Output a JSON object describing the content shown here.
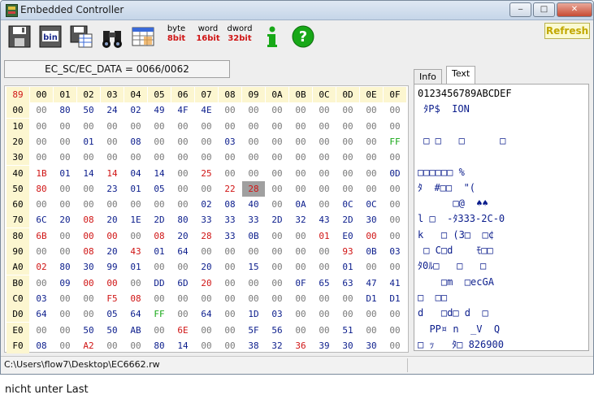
{
  "window": {
    "title": "Embedded Controller",
    "min": "‒",
    "max": "□",
    "close": "✕"
  },
  "toolbar": {
    "buttons": [
      {
        "name": "save",
        "icon": "floppy-disk-icon"
      },
      {
        "name": "open-bin",
        "icon": "bin-file-icon",
        "label": "bin"
      },
      {
        "name": "save-as",
        "icon": "floppy-grid-icon"
      },
      {
        "name": "find",
        "icon": "binoculars-icon"
      },
      {
        "name": "table",
        "icon": "table-icon"
      }
    ],
    "byte": {
      "top": "byte",
      "bottom": "8bit"
    },
    "word": {
      "top": "word",
      "bottom": "16bit"
    },
    "dword": {
      "top": "dword",
      "bottom": "32bit"
    },
    "info_icon": "info-icon",
    "help_icon": "help-icon",
    "refresh_label": "Refresh",
    "accent_colors": {
      "byte": "#d01515",
      "word": "#d01515",
      "dword": "#d01515"
    }
  },
  "ec_label": "EC_SC/EC_DATA = 0066/0062",
  "hex": {
    "corner": "89",
    "cols": [
      "00",
      "01",
      "02",
      "03",
      "04",
      "05",
      "06",
      "07",
      "08",
      "09",
      "0A",
      "0B",
      "0C",
      "0D",
      "0E",
      "0F"
    ],
    "rows": [
      {
        "addr": "00",
        "vals": [
          "00",
          "80",
          "50",
          "24",
          "02",
          "49",
          "4F",
          "4E",
          "00",
          "00",
          "00",
          "00",
          "00",
          "00",
          "00",
          "00"
        ]
      },
      {
        "addr": "10",
        "vals": [
          "00",
          "00",
          "00",
          "00",
          "00",
          "00",
          "00",
          "00",
          "00",
          "00",
          "00",
          "00",
          "00",
          "00",
          "00",
          "00"
        ]
      },
      {
        "addr": "20",
        "vals": [
          "00",
          "00",
          "01",
          "00",
          "08",
          "00",
          "00",
          "00",
          "03",
          "00",
          "00",
          "00",
          "00",
          "00",
          "00",
          "FF"
        ]
      },
      {
        "addr": "30",
        "vals": [
          "00",
          "00",
          "00",
          "00",
          "00",
          "00",
          "00",
          "00",
          "00",
          "00",
          "00",
          "00",
          "00",
          "00",
          "00",
          "00"
        ]
      },
      {
        "addr": "40",
        "vals": [
          "1B",
          "01",
          "14",
          "14",
          "04",
          "14",
          "00",
          "25",
          "00",
          "00",
          "00",
          "00",
          "00",
          "00",
          "00",
          "0D"
        ]
      },
      {
        "addr": "50",
        "vals": [
          "80",
          "00",
          "00",
          "23",
          "01",
          "05",
          "00",
          "00",
          "22",
          "28",
          "00",
          "00",
          "00",
          "00",
          "00",
          "00"
        ]
      },
      {
        "addr": "60",
        "vals": [
          "00",
          "00",
          "00",
          "00",
          "00",
          "00",
          "00",
          "02",
          "08",
          "40",
          "00",
          "0A",
          "00",
          "0C",
          "0C",
          "00"
        ]
      },
      {
        "addr": "70",
        "vals": [
          "6C",
          "20",
          "08",
          "20",
          "1E",
          "2D",
          "80",
          "33",
          "33",
          "33",
          "2D",
          "32",
          "43",
          "2D",
          "30",
          "00"
        ]
      },
      {
        "addr": "80",
        "vals": [
          "6B",
          "00",
          "00",
          "00",
          "00",
          "08",
          "20",
          "28",
          "33",
          "0B",
          "00",
          "00",
          "01",
          "E0",
          "00",
          "00"
        ]
      },
      {
        "addr": "90",
        "vals": [
          "00",
          "00",
          "08",
          "20",
          "43",
          "01",
          "64",
          "00",
          "00",
          "00",
          "00",
          "00",
          "00",
          "93",
          "0B",
          "03"
        ]
      },
      {
        "addr": "A0",
        "vals": [
          "02",
          "80",
          "30",
          "99",
          "01",
          "00",
          "00",
          "20",
          "00",
          "15",
          "00",
          "00",
          "00",
          "01",
          "00",
          "00"
        ]
      },
      {
        "addr": "B0",
        "vals": [
          "00",
          "09",
          "00",
          "00",
          "00",
          "DD",
          "6D",
          "20",
          "00",
          "00",
          "00",
          "0F",
          "65",
          "63",
          "47",
          "41"
        ]
      },
      {
        "addr": "C0",
        "vals": [
          "03",
          "00",
          "00",
          "F5",
          "08",
          "00",
          "00",
          "00",
          "00",
          "00",
          "00",
          "00",
          "00",
          "00",
          "D1",
          "D1"
        ]
      },
      {
        "addr": "D0",
        "vals": [
          "64",
          "00",
          "00",
          "05",
          "64",
          "FF",
          "00",
          "64",
          "00",
          "1D",
          "03",
          "00",
          "00",
          "00",
          "00",
          "00"
        ]
      },
      {
        "addr": "E0",
        "vals": [
          "00",
          "00",
          "50",
          "50",
          "AB",
          "00",
          "6E",
          "00",
          "00",
          "5F",
          "56",
          "00",
          "00",
          "51",
          "00",
          "00"
        ]
      },
      {
        "addr": "F0",
        "vals": [
          "08",
          "00",
          "A2",
          "00",
          "00",
          "80",
          "14",
          "00",
          "00",
          "38",
          "32",
          "36",
          "39",
          "30",
          "30",
          "00"
        ]
      }
    ],
    "selected": {
      "row": 5,
      "col": 9
    },
    "colors": {
      "red": "#d01515",
      "blue": "#0b1d8c",
      "gray": "#7a7a7a",
      "green": "#18a818",
      "header_bg": "#fcf6d0",
      "selected_bg": "#a0a0a0"
    }
  },
  "tabs": [
    {
      "label": "Info"
    },
    {
      "label": "Text",
      "active": true
    }
  ],
  "text_panel": {
    "header": "0123456789ABCDEF",
    "lines": [
      " ﾀP$  ION",
      "",
      " □ □   □      □",
      "",
      "□□□□□□ %",
      "ﾀ  #□□  \"(",
      "      □@  ♠♠",
      "l □  -ﾀ333-2C-0",
      "k   □ (3□  □¢",
      " □ C□d    ﾓ□□",
      "ﾀ0ﾙ□   □   □",
      "    □m  □ecGA",
      "□  □□",
      "d   □d□ d  □",
      "  PP¤ n  _V  Q",
      "□ ｯ   ﾀ□ 826900"
    ]
  },
  "status": {
    "path": "C:\\Users\\flow7\\Desktop\\EC6662.rw"
  },
  "caption": "nicht unter Last"
}
